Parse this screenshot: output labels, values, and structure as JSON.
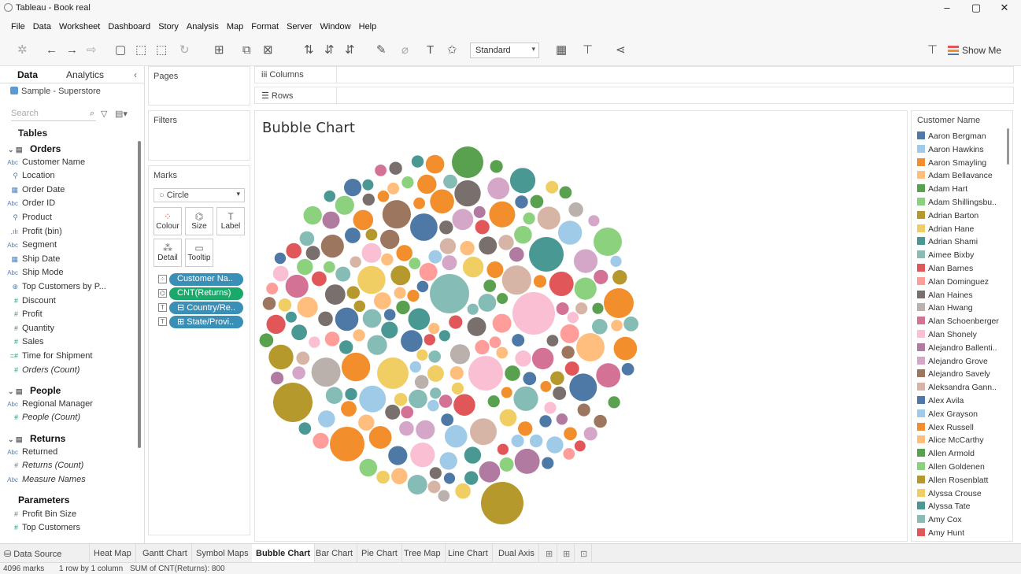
{
  "window": {
    "title": "Tableau - Book real",
    "minimize": "–",
    "maximize": "▢",
    "close": "✕"
  },
  "menu": [
    "File",
    "Data",
    "Worksheet",
    "Dashboard",
    "Story",
    "Analysis",
    "Map",
    "Format",
    "Server",
    "Window",
    "Help"
  ],
  "toolbar": {
    "fit": "Standard",
    "show_me": "Show Me"
  },
  "datapane": {
    "tab_data": "Data",
    "tab_analytics": "Analytics",
    "datasource": "Sample - Superstore",
    "search_placeholder": "Search",
    "tables_label": "Tables",
    "fields": [
      {
        "type": "table",
        "label": "Orders"
      },
      {
        "type": "abc",
        "label": "Customer Name"
      },
      {
        "type": "geo",
        "label": "Location"
      },
      {
        "type": "date",
        "label": "Order Date"
      },
      {
        "type": "abc",
        "label": "Order ID"
      },
      {
        "type": "geo",
        "label": "Product"
      },
      {
        "type": "bin",
        "label": "Profit (bin)"
      },
      {
        "type": "abc",
        "label": "Segment"
      },
      {
        "type": "date",
        "label": "Ship Date"
      },
      {
        "type": "abc",
        "label": "Ship Mode"
      },
      {
        "type": "set",
        "label": "Top Customers by P..."
      },
      {
        "type": "num",
        "label": "Discount"
      },
      {
        "type": "num",
        "label": "Profit"
      },
      {
        "type": "num",
        "label": "Quantity"
      },
      {
        "type": "num",
        "label": "Sales"
      },
      {
        "type": "calc",
        "label": "Time for Shipment"
      },
      {
        "type": "numi",
        "label": "Orders (Count)"
      },
      {
        "type": "table",
        "label": "People"
      },
      {
        "type": "abc",
        "label": "Regional Manager"
      },
      {
        "type": "numi",
        "label": "People (Count)"
      },
      {
        "type": "table",
        "label": "Returns"
      },
      {
        "type": "abc",
        "label": "Returned"
      },
      {
        "type": "numi",
        "label": "Returns (Count)"
      },
      {
        "type": "abci",
        "label": "Measure Names"
      }
    ],
    "parameters_label": "Parameters",
    "parameters": [
      "Profit Bin Size",
      "Top Customers"
    ]
  },
  "shelves": {
    "pages": "Pages",
    "filters": "Filters",
    "marks": "Marks",
    "mark_type": "Circle",
    "mark_buttons": [
      "Colour",
      "Size",
      "Label",
      "Detail",
      "Tooltip"
    ],
    "pills": [
      {
        "label": "Customer Na..",
        "color": "#3a8fb7"
      },
      {
        "label": "CNT(Returns)",
        "color": "#1ba86b"
      },
      {
        "label": "⊟ Country/Re..",
        "color": "#3a8fb7"
      },
      {
        "label": "⊞ State/Provi..",
        "color": "#3a8fb7"
      }
    ],
    "columns": "Columns",
    "rows": "Rows"
  },
  "chart_data": {
    "type": "bubble",
    "title": "Bubble Chart",
    "size_measure": "CNT(Returns)",
    "color_dimension": "Customer Name"
  },
  "legend": {
    "title": "Customer Name",
    "items": [
      {
        "name": "Aaron Bergman",
        "color": "#4e79a7"
      },
      {
        "name": "Aaron Hawkins",
        "color": "#a0cbe8"
      },
      {
        "name": "Aaron Smayling",
        "color": "#f28e2b"
      },
      {
        "name": "Adam Bellavance",
        "color": "#ffbe7d"
      },
      {
        "name": "Adam Hart",
        "color": "#59a14f"
      },
      {
        "name": "Adam Shillingsbu..",
        "color": "#8cd17d"
      },
      {
        "name": "Adrian Barton",
        "color": "#b6992d"
      },
      {
        "name": "Adrian Hane",
        "color": "#f1ce63"
      },
      {
        "name": "Adrian Shami",
        "color": "#499894"
      },
      {
        "name": "Aimee Bixby",
        "color": "#86bcb6"
      },
      {
        "name": "Alan Barnes",
        "color": "#e15759"
      },
      {
        "name": "Alan Dominguez",
        "color": "#ff9d9a"
      },
      {
        "name": "Alan Haines",
        "color": "#79706e"
      },
      {
        "name": "Alan Hwang",
        "color": "#bab0ac"
      },
      {
        "name": "Alan Schoenberger",
        "color": "#d37295"
      },
      {
        "name": "Alan Shonely",
        "color": "#fabfd2"
      },
      {
        "name": "Alejandro Ballenti..",
        "color": "#b07aa1"
      },
      {
        "name": "Alejandro Grove",
        "color": "#d4a6c8"
      },
      {
        "name": "Alejandro Savely",
        "color": "#9d7660"
      },
      {
        "name": "Aleksandra Gann..",
        "color": "#d7b5a6"
      },
      {
        "name": "Alex Avila",
        "color": "#4e79a7"
      },
      {
        "name": "Alex Grayson",
        "color": "#a0cbe8"
      },
      {
        "name": "Alex Russell",
        "color": "#f28e2b"
      },
      {
        "name": "Alice McCarthy",
        "color": "#ffbe7d"
      },
      {
        "name": "Allen Armold",
        "color": "#59a14f"
      },
      {
        "name": "Allen Goldenen",
        "color": "#8cd17d"
      },
      {
        "name": "Allen Rosenblatt",
        "color": "#b6992d"
      },
      {
        "name": "Alyssa Crouse",
        "color": "#f1ce63"
      },
      {
        "name": "Alyssa Tate",
        "color": "#499894"
      },
      {
        "name": "Amy Cox",
        "color": "#86bcb6"
      },
      {
        "name": "Amy Hunt",
        "color": "#e15759"
      }
    ]
  },
  "sheet_tabs": {
    "datasource": "Data Source",
    "sheets": [
      "Heat Map",
      "Gantt Chart",
      "Symbol Maps",
      "Bubble Chart",
      "Bar Chart",
      "Pie Chart",
      "Tree Map",
      "Line Chart",
      "Dual Axis"
    ],
    "active": "Bubble Chart"
  },
  "status": {
    "marks": "4096 marks",
    "rowscols": "1 row by 1 column",
    "sum": "SUM of CNT(Returns): 800"
  }
}
